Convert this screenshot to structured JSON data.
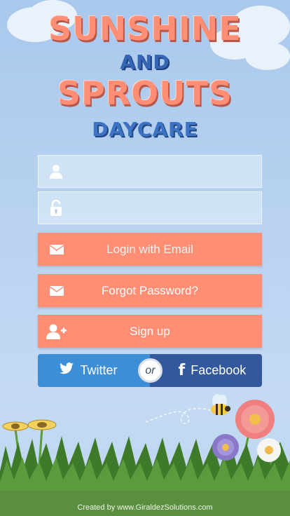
{
  "logo": {
    "line1": "SUNSHINE",
    "line2": "AND",
    "line3": "SPROUTS",
    "line4": "DAYCARE"
  },
  "form": {
    "username": {
      "value": "",
      "placeholder": "",
      "icon": "user-icon"
    },
    "password": {
      "value": "",
      "placeholder": "",
      "icon": "lock-icon"
    }
  },
  "buttons": {
    "login": {
      "label": "Login with Email",
      "icon": "envelope-icon"
    },
    "forgot": {
      "label": "Forgot Password?",
      "icon": "envelope-icon"
    },
    "signup": {
      "label": "Sign up",
      "icon": "add-user-icon"
    }
  },
  "social": {
    "twitter": "Twitter",
    "or": "or",
    "facebook": "Facebook"
  },
  "footer": {
    "credit": "Created by www.GiraldezSolutions.com"
  },
  "colors": {
    "accent": "#ff8e75",
    "twitter": "#3c8ed6",
    "facebook": "#33589e",
    "sky": "#b9d3f0",
    "grass": "#4c8a30"
  }
}
